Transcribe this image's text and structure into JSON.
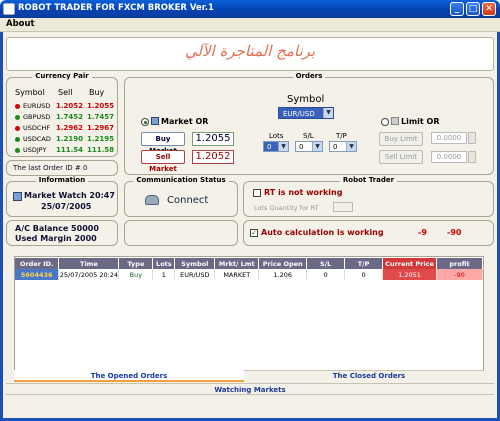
{
  "window": {
    "title": "ROBOT TRADER FOR FXCM BROKER Ver.1"
  },
  "menu": {
    "about": "About"
  },
  "banner": {
    "text": "برنامج المتاجرة الآلي"
  },
  "currency_pair": {
    "title": "Currency Pair",
    "headers": [
      "Symbol",
      "Sell",
      "Buy"
    ],
    "rows": [
      {
        "symbol": "EURUSD",
        "sell": "1.2052",
        "buy": "1.2055",
        "color": "#cc0000"
      },
      {
        "symbol": "GBPUSD",
        "sell": "1.7452",
        "buy": "1.7457",
        "color": "#1a8a1a"
      },
      {
        "symbol": "USDCHF",
        "sell": "1.2962",
        "buy": "1.2967",
        "color": "#cc0000"
      },
      {
        "symbol": "USDCAD",
        "sell": "1.2190",
        "buy": "1.2195",
        "color": "#1a8a1a"
      },
      {
        "symbol": "USDJPY",
        "sell": "111.54",
        "buy": "111.58",
        "color": "#1a8a1a"
      }
    ],
    "last_order": "The last Order ID # 0"
  },
  "orders_panel": {
    "title": "Orders",
    "symbol_label": "Symbol",
    "symbol_value": "EUR/USD",
    "market_or": "Market OR",
    "limit_or": "Limit OR",
    "buy_market": "Buy Market",
    "sell_market": "Sell Market",
    "buy_value": "1.2055",
    "sell_value": "1.2052",
    "lots_label": "Lots",
    "sl_label": "S/L",
    "tp_label": "T/P",
    "lots_value": "0",
    "sl_value": "0",
    "tp_value": "0",
    "buy_limit": "Buy Limit",
    "sell_limit": "Sell Limit",
    "buy_limit_value": "0.0000",
    "sell_limit_value": "0.0000"
  },
  "information": {
    "title": "Information",
    "market_watch": "Market Watch 20:47",
    "date": "25/07/2005",
    "balance": "A/C Balance  50000",
    "margin": "Used Margin  2000"
  },
  "communication": {
    "title": "Communication Status",
    "status": "Connect"
  },
  "robot": {
    "title": "Robot Trader",
    "rt_status": "RT is not working",
    "lots_qty_label": "Lots Quantity for RT",
    "auto_calc": "Auto calculation is working",
    "val1": "-9",
    "val2": "-90"
  },
  "orders_table": {
    "headers": [
      "Order ID.",
      "Time",
      "Type",
      "Lots",
      "Symbol",
      "Mrkt/ Lmt",
      "Price Open",
      "S/L",
      "T/P",
      "Current Price",
      "profit"
    ],
    "rows": [
      [
        "5604436",
        "25/07/2005  20:24",
        "Buy",
        "1",
        "EUR/USD",
        "MARKET",
        "1.206",
        "0",
        "0",
        "1.2051",
        "-90"
      ]
    ]
  },
  "tabs": {
    "opened": "The Opened Orders",
    "closed": "The Closed Orders",
    "watching": "Watching Markets"
  },
  "colors": {
    "titlebar": "#0842b0",
    "accent_red": "#cc0000",
    "accent_green": "#1a8a1a"
  }
}
